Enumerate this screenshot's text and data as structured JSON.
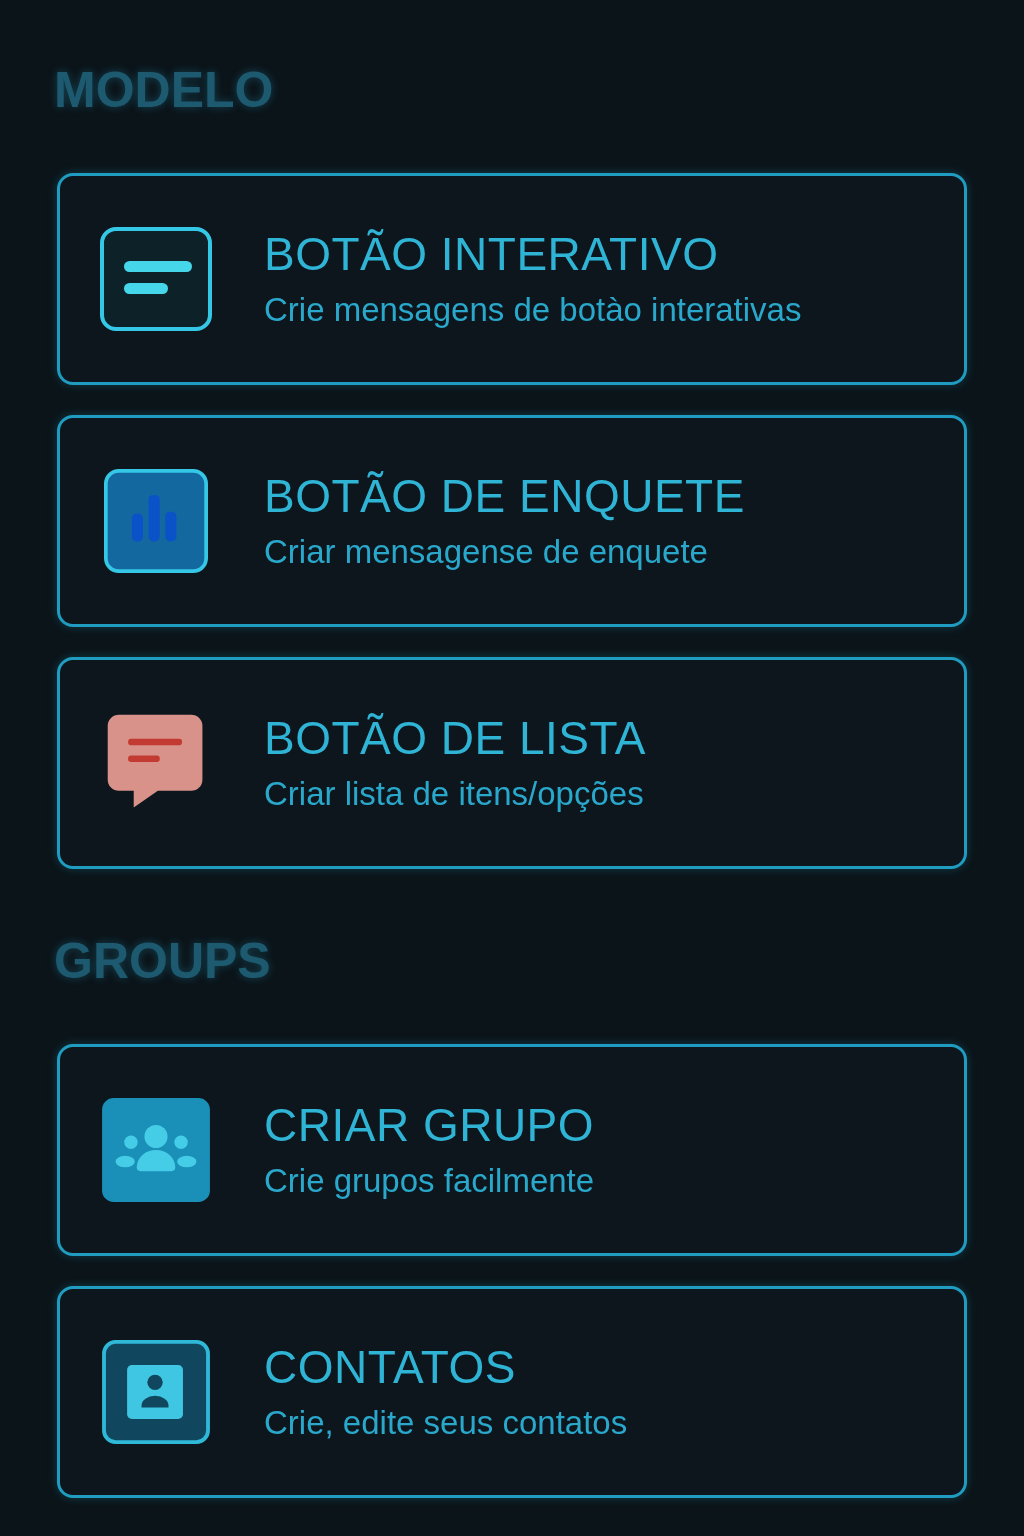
{
  "sections": [
    {
      "title": "MODELO",
      "items": [
        {
          "kind": "lines",
          "title": "BOTÃO INTERATIVO",
          "subtitle": "Crie mensagens de botào interativas"
        },
        {
          "kind": "bars",
          "title": "BOTÃO DE ENQUETE",
          "subtitle": "Criar mensagense de enquete"
        },
        {
          "kind": "chat",
          "title": "BOTÃO DE LISTA",
          "subtitle": "Criar lista de itens/opções"
        }
      ]
    },
    {
      "title": "GROUPS",
      "items": [
        {
          "kind": "group",
          "title": "CRIAR GRUPO",
          "subtitle": "Crie grupos facilmente"
        },
        {
          "kind": "contact",
          "title": "CONTATOS",
          "subtitle": "Crie, edite seus contatos"
        }
      ]
    }
  ]
}
